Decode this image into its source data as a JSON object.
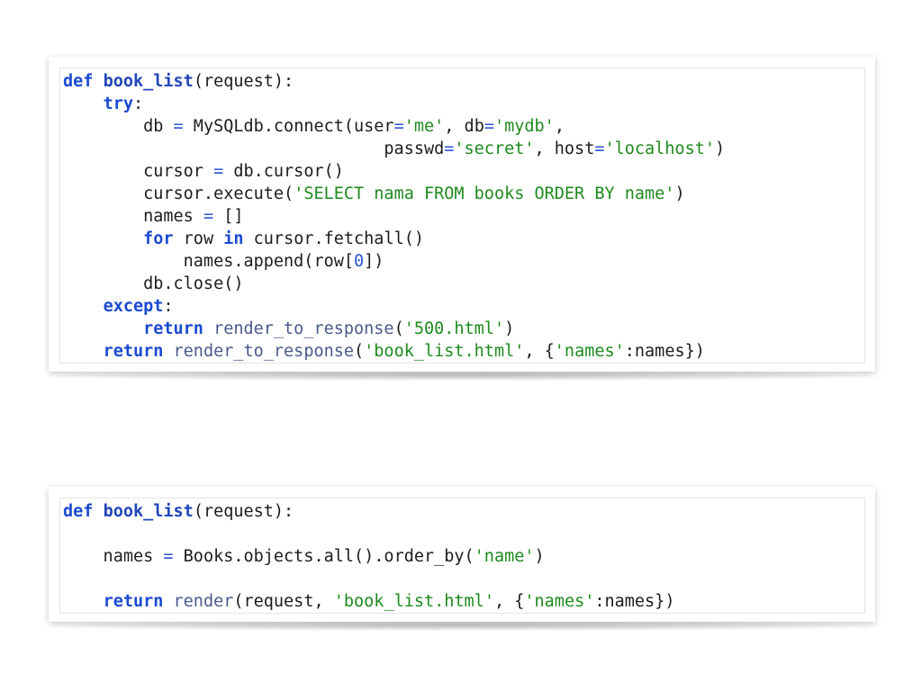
{
  "snippets": [
    {
      "id": "raw-sql",
      "lines": [
        "def book_list(request):",
        "    try:",
        "        db = MySQLdb.connect(user='me', db='mydb',",
        "                                passwd='secret', host='localhost')",
        "        cursor = db.cursor()",
        "        cursor.execute('SELECT nama FROM books ORDER BY name')",
        "        names = []",
        "        for row in cursor.fetchall()",
        "            names.append(row[0])",
        "        db.close()",
        "    except:",
        "        return render_to_response('500.html')",
        "    return render_to_response('book_list.html', {'names':names})"
      ]
    },
    {
      "id": "django-orm",
      "lines": [
        "def book_list(request):",
        "",
        "    names = Books.objects.all().order_by('name')",
        "",
        "    return render(request, 'book_list.html', {'names':names})"
      ]
    }
  ]
}
